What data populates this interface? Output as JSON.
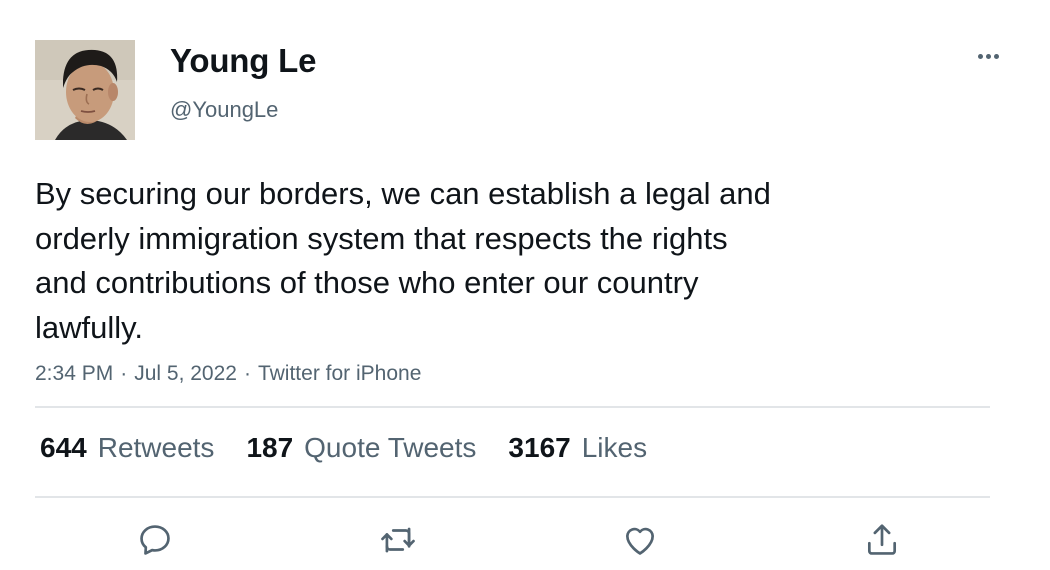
{
  "author": {
    "display_name": "Young Le",
    "handle": "@YoungLe"
  },
  "tweet": {
    "text": "By securing our borders, we can establish a legal and\norderly immigration system that respects the rights\nand contributions of those who enter our country\nlawfully.",
    "time": "2:34 PM",
    "date": "Jul 5, 2022",
    "source": "Twitter for iPhone",
    "separator": "·"
  },
  "stats": {
    "retweets": {
      "count": "644",
      "label": "Retweets"
    },
    "quote_tweets": {
      "count": "187",
      "label": "Quote Tweets"
    },
    "likes": {
      "count": "3167",
      "label": "Likes"
    }
  },
  "actions": [
    {
      "name": "reply",
      "icon": "reply-icon"
    },
    {
      "name": "retweet",
      "icon": "retweet-icon"
    },
    {
      "name": "like",
      "icon": "heart-icon"
    },
    {
      "name": "share",
      "icon": "share-icon"
    }
  ],
  "colors": {
    "text": "#0f1419",
    "secondary": "#536471",
    "divider": "#e2e5e8"
  }
}
